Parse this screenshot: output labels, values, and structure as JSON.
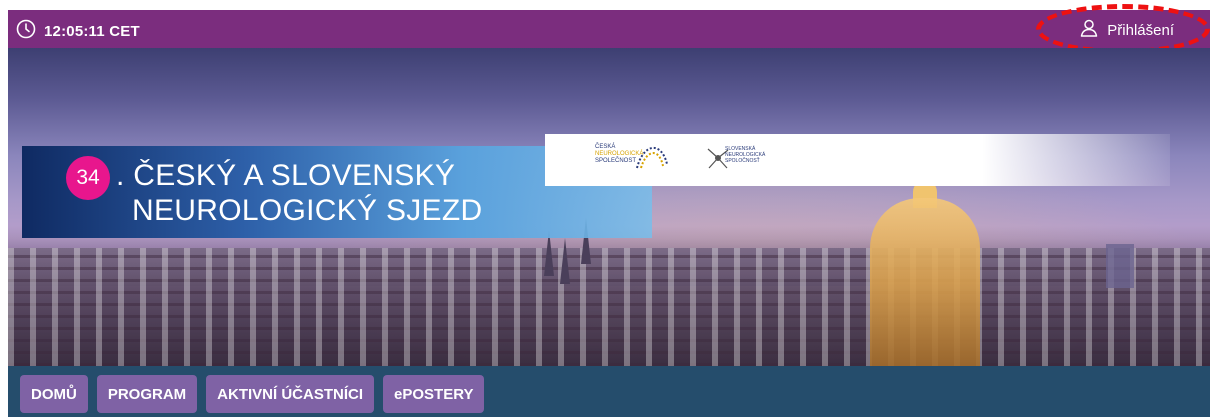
{
  "header": {
    "time": "12:05:11",
    "timezone": "CET",
    "login_label": "Přihlášení",
    "bar_color": "#7b2d7e",
    "highlight_color": "#ee1111"
  },
  "banner": {
    "number": "34",
    "title_line1": "ČESKÝ A SLOVENSKÝ",
    "title_line2": "NEUROLOGICKÝ SJEZD",
    "logos": {
      "czech": {
        "line1": "ČESKÁ",
        "line2": "NEUROLOGICKÁ",
        "line3": "SPOLEČNOST"
      },
      "slovak": {
        "line1": "SLOVENSKÁ",
        "line2": "NEUROLOGICKÁ",
        "line3": "SPOLOČNOSŤ"
      }
    },
    "badge_color": "#e8168d"
  },
  "nav": {
    "items": [
      {
        "label": "DOMŮ"
      },
      {
        "label": "PROGRAM"
      },
      {
        "label": "AKTIVNÍ ÚČASTNÍCI"
      },
      {
        "label": "ePOSTERY"
      }
    ],
    "bg_color": "#254d6c",
    "button_color": "#7f62a5"
  }
}
